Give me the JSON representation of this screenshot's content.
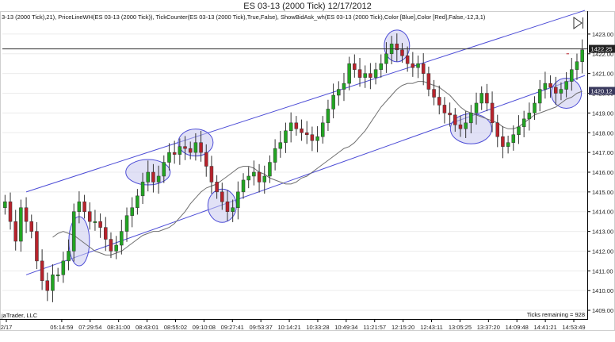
{
  "chart_data": {
    "type": "candlestick",
    "title": "ES 03-13 (2000 Tick)  12/17/2012",
    "indicator_line": "3-13 (2000 Tick),21), PriceLineWH(ES 03-13 (2000 Tick)), TickCounter(ES 03-13 (2000 Tick),True,False), ShowBidAsk_wh(ES 03-13 (2000 Tick),Color [Blue],Color [Red],False,-12,3,1)",
    "credit": "jaTrader, LLC",
    "ticks_remaining": "Ticks remaining = 928",
    "ylim": [
      1408.6,
      1423.6
    ],
    "y_ticks": [
      "1409.00",
      "1410.00",
      "1411.00",
      "1412.00",
      "1413.00",
      "1414.00",
      "1415.00",
      "1416.00",
      "1417.00",
      "1418.00",
      "1419.00",
      "1420.00",
      "1421.00",
      "1422.00",
      "1423.00"
    ],
    "x_ticks": [
      "2/17",
      "05:14:59",
      "07:29:54",
      "08:31:00",
      "08:43:01",
      "08:55:02",
      "09:10:08",
      "09:27:41",
      "09:53:37",
      "10:14:21",
      "10:33:28",
      "10:49:34",
      "11:21:57",
      "12:15:20",
      "12:43:11",
      "13:05:25",
      "13:37:20",
      "14:09:48",
      "14:41:21",
      "14:53:49"
    ],
    "last_price": "1422.25",
    "ma_price": "1420.12",
    "up_color": "#22a422",
    "down_color": "#b8232c",
    "ma_color": "#707070",
    "channel_color": "#4c4cd6",
    "highlight_fill": "#c8c8ee",
    "bar_values": [
      1414.5,
      1413.5,
      1412.5,
      1414.2,
      1413.5,
      1413.0,
      1411.5,
      1410.5,
      1410.0,
      1410.8,
      1410.8,
      1411.5,
      1412.0,
      1414.0,
      1414.5,
      1414.0,
      1413.5,
      1413.5,
      1413.2,
      1412.6,
      1412.0,
      1412.3,
      1413.0,
      1413.8,
      1414.2,
      1414.8,
      1415.5,
      1416.0,
      1415.5,
      1415.8,
      1416.5,
      1417.0,
      1416.9,
      1417.3,
      1417.2,
      1417.0,
      1417.5,
      1417.0,
      1416.3,
      1415.5,
      1415.0,
      1414.5,
      1414.0,
      1414.2,
      1415.0,
      1415.6,
      1415.8,
      1416.0,
      1415.5,
      1415.8,
      1416.5,
      1417.2,
      1417.5,
      1418.1,
      1418.5,
      1418.2,
      1418.0,
      1417.9,
      1417.6,
      1417.8,
      1418.5,
      1419.2,
      1419.9,
      1420.2,
      1420.5,
      1421.5,
      1421.2,
      1420.8,
      1421.0,
      1420.8,
      1421.2,
      1421.5,
      1422.0,
      1422.5,
      1422.2,
      1421.9,
      1421.5,
      1421.3,
      1421.5,
      1421.0,
      1420.2,
      1419.8,
      1419.4,
      1419.0,
      1418.9,
      1418.4,
      1418.2,
      1418.5,
      1419.0,
      1419.5,
      1420.0,
      1419.5,
      1418.5,
      1417.8,
      1417.3,
      1417.5,
      1417.9,
      1418.3,
      1418.7,
      1419.0,
      1419.5,
      1420.2,
      1420.5,
      1420.3,
      1420.0,
      1420.2,
      1420.6,
      1421.2,
      1421.6,
      1422.2
    ],
    "ma_values": [
      1412.7,
      1412.9,
      1413.0,
      1412.9,
      1412.8,
      1412.6,
      1412.4,
      1412.2,
      1412.0,
      1411.9,
      1411.8,
      1411.8,
      1411.9,
      1412.0,
      1412.2,
      1412.4,
      1412.6,
      1412.8,
      1412.9,
      1413.0,
      1413.0,
      1413.1,
      1413.2,
      1413.4,
      1413.7,
      1414.0,
      1414.4,
      1414.7,
      1415.0,
      1415.2,
      1415.3,
      1415.4,
      1415.6,
      1415.8,
      1416.0,
      1416.2,
      1416.3,
      1416.3,
      1416.2,
      1416.0,
      1415.9,
      1415.7,
      1415.6,
      1415.5,
      1415.4,
      1415.4,
      1415.5,
      1415.7,
      1415.8,
      1416.0,
      1416.2,
      1416.4,
      1416.6,
      1416.8,
      1417.0,
      1417.2,
      1417.3,
      1417.5,
      1417.8,
      1418.1,
      1418.5,
      1418.9,
      1419.3,
      1419.6,
      1419.9,
      1420.2,
      1420.4,
      1420.5,
      1420.5,
      1420.6,
      1420.6,
      1420.5,
      1420.4,
      1420.3,
      1420.1,
      1419.9,
      1419.6,
      1419.3,
      1419.1,
      1419.0,
      1418.9,
      1418.8,
      1418.7,
      1418.6,
      1418.5,
      1418.3,
      1418.2,
      1418.2,
      1418.3,
      1418.5,
      1418.7,
      1418.9,
      1419.0,
      1419.1,
      1419.2,
      1419.3,
      1419.5,
      1419.7,
      1419.8,
      1420.0,
      1420.1
    ],
    "channel_upper": [
      [
        1415.0,
        1424.2
      ]
    ],
    "channel_lower": [
      [
        1410.8,
        1420.9
      ]
    ],
    "channel_top": [
      1415.0,
      1424.2
    ],
    "channel_bottom": [
      1410.8,
      1420.9
    ],
    "highlights": [
      {
        "bar": 27,
        "price": 1416.0
      },
      {
        "bar": 36,
        "price": 1417.5
      },
      {
        "bar": 14,
        "price": 1412.5
      },
      {
        "bar": 41,
        "price": 1414.3
      },
      {
        "bar": 74,
        "price": 1422.4
      },
      {
        "bar": 88,
        "price": 1418.2
      },
      {
        "bar": 106,
        "price": 1420.0
      }
    ],
    "price_line_start_bar": 106
  }
}
